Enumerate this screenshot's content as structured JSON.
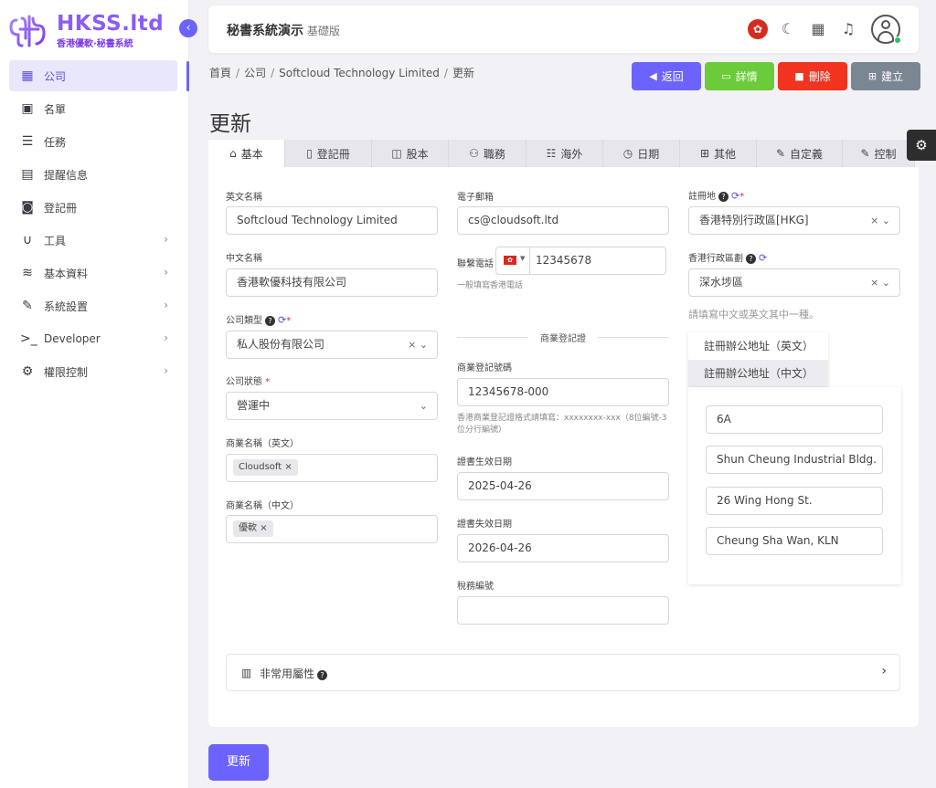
{
  "brand": {
    "title": "HKSS.ltd",
    "subtitle": "香港優軟·秘書系統"
  },
  "sidebar": {
    "items": [
      {
        "label": "公司",
        "icon": "building-icon"
      },
      {
        "label": "名單",
        "icon": "contact-card-icon"
      },
      {
        "label": "任務",
        "icon": "checklist-icon"
      },
      {
        "label": "提醒信息",
        "icon": "calendar-icon"
      },
      {
        "label": "登記冊",
        "icon": "register-icon"
      },
      {
        "label": "工具",
        "icon": "magnet-icon"
      },
      {
        "label": "基本資料",
        "icon": "database-icon"
      },
      {
        "label": "系統設置",
        "icon": "wrench-icon"
      },
      {
        "label": "Developer",
        "icon": "terminal-icon"
      },
      {
        "label": "權限控制",
        "icon": "cogs-icon"
      }
    ]
  },
  "topbar": {
    "title": "秘書系統演示",
    "edition": "基礎版"
  },
  "breadcrumb": [
    "首頁",
    "公司",
    "Softcloud Technology Limited",
    "更新"
  ],
  "actions": {
    "back": "返回",
    "detail": "詳情",
    "delete": "刪除",
    "create": "建立"
  },
  "page_title": "更新",
  "tabs": [
    {
      "label": "基本",
      "icon": "home-icon"
    },
    {
      "label": "登記冊",
      "icon": "file-icon"
    },
    {
      "label": "股本",
      "icon": "money-icon"
    },
    {
      "label": "職務",
      "icon": "users-icon"
    },
    {
      "label": "海外",
      "icon": "server-icon"
    },
    {
      "label": "日期",
      "icon": "clock-icon"
    },
    {
      "label": "其他",
      "icon": "grid-icon"
    },
    {
      "label": "自定義",
      "icon": "user-edit-icon"
    },
    {
      "label": "控制",
      "icon": "user-control-icon"
    }
  ],
  "form": {
    "english_name": {
      "label": "英文名稱",
      "value": "Softcloud Technology Limited"
    },
    "chinese_name": {
      "label": "中文名稱",
      "value": "香港軟優科技有限公司"
    },
    "company_type": {
      "label": "公司類型",
      "value": "私人股份有限公司"
    },
    "company_status": {
      "label": "公司狀態",
      "value": "營運中"
    },
    "trade_name_en": {
      "label": "商業名稱（英文）",
      "tag": "Cloudsoft"
    },
    "trade_name_zh": {
      "label": "商業名稱（中文）",
      "tag": "優軟"
    },
    "email": {
      "label": "電子郵箱",
      "value": "cs@cloudsoft.ltd"
    },
    "phone": {
      "label": "聯繫電話",
      "value": "12345678",
      "help": "一般填寫香港電話"
    },
    "br_section": "商業登記證",
    "br_number": {
      "label": "商業登記號碼",
      "value": "12345678-000",
      "help": "香港商業登記證格式請填寫：xxxxxxxx-xxx（8位編號-3位分行編號）"
    },
    "cert_start": {
      "label": "證書生效日期",
      "value": "2025-04-26"
    },
    "cert_end": {
      "label": "證書失效日期",
      "value": "2026-04-26"
    },
    "tax_no": {
      "label": "稅務編號",
      "value": ""
    },
    "domicile": {
      "label": "註冊地",
      "value": "香港特別行政區[HKG]"
    },
    "district": {
      "label": "香港行政區劃",
      "value": "深水埗區"
    },
    "address_hint": "請填寫中文或英文其中一種。",
    "address_tabs": [
      "註冊辦公地址（英文）",
      "註冊辦公地址（中文）"
    ],
    "address_lines": [
      "6A",
      "Shun Cheung Industrial Bldg.",
      "26 Wing Hong St.",
      "Cheung Sha Wan, KLN"
    ],
    "extra_section": "非常用屬性"
  },
  "submit": "更新",
  "colors": {
    "primary": "#6c63ff",
    "success": "#6ccb3a",
    "danger": "#f0341f",
    "neutral": "#7a8792"
  }
}
